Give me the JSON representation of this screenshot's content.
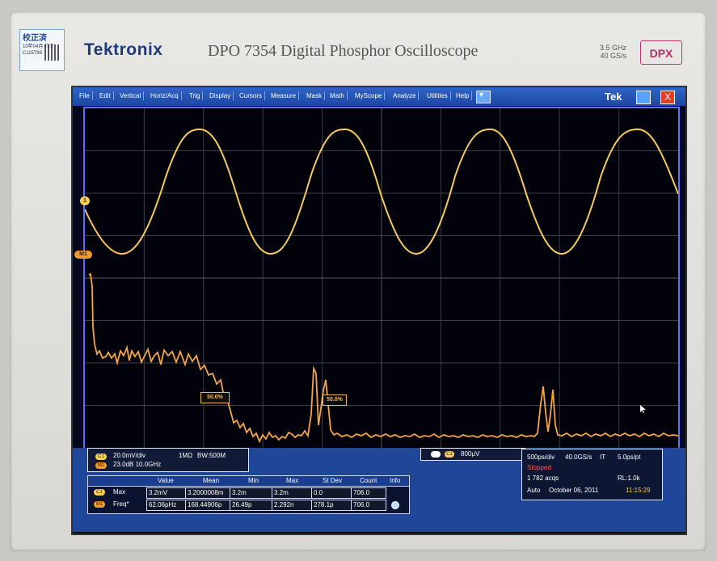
{
  "sticker": {
    "title": "校正済",
    "line1": "10年04月 校正",
    "line2": "C115799"
  },
  "brand": {
    "logo": "Tektronix",
    "model": "DPO 7354  Digital Phosphor Oscilloscope",
    "spec1": "3.5 GHz",
    "spec2": "40 GS/s",
    "badge": "DPX"
  },
  "menu": {
    "items": [
      "File",
      "Edit",
      "Vertical",
      "Horiz/Acq",
      "Trig",
      "Display",
      "Cursors",
      "Measure",
      "Mask",
      "Math",
      "MyScope",
      "Analyze",
      "Utilities",
      "Help"
    ],
    "tek_label": "Tek",
    "close_symbol": "X",
    "dropdown_symbol": "▾"
  },
  "plot": {
    "top_marker_1": "1",
    "top_marker_2": "M1",
    "ref_left": "50.0%",
    "ref_right": "50.0%"
  },
  "channel_info": {
    "c1_chip": "C1",
    "c1_text": "20.0mV/div",
    "c1_impedance": "1MΩ",
    "c1_bw": "BW:500M",
    "m1_chip": "M1",
    "m1_text": "23.0dB  10.0GHz"
  },
  "trigger": {
    "chip": "C1",
    "text": "800µV"
  },
  "acq_status": {
    "timebase": "500ps/div",
    "rate": "40.0GS/s",
    "mode": "IT",
    "pt": "5.0ps/pt",
    "state": "Stopped",
    "acqs": "1 782 acqs",
    "rl": "RL:1.0k",
    "trigger_mode": "Auto",
    "date": "October 06, 2011",
    "time": "11:15:29"
  },
  "measurements": {
    "headers": [
      "Value",
      "Mean",
      "Min",
      "Max",
      "St Dev",
      "Count",
      "Info"
    ],
    "rows": [
      {
        "name": "Max",
        "chip": "C1",
        "values": [
          "3.2mV",
          "3.2000008m",
          "3.2m",
          "3.2m",
          "0.0",
          "706.0",
          ""
        ]
      },
      {
        "name": "Freq*",
        "chip": "M1",
        "values": [
          "62.06pHz",
          "168.44906p",
          "26.49p",
          "2.292n",
          "278.1p",
          "706.0",
          ""
        ]
      }
    ]
  },
  "colors": {
    "screen_bg": "#02030a",
    "grid": "#6b6f7c",
    "trace": "#f5c95d",
    "spectrum": "#f4a546",
    "border": "#5c70ff",
    "menu_blue": "#1f4ea9"
  }
}
